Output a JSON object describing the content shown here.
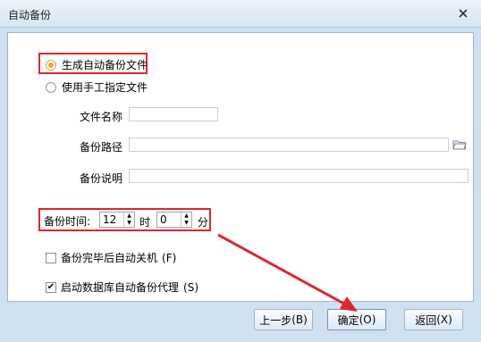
{
  "window": {
    "title": "自动备份"
  },
  "options": {
    "auto_generate": "生成自动备份文件",
    "manual_file": "使用手工指定文件",
    "selected": "auto_generate"
  },
  "fields": {
    "file_name_label": "文件名称",
    "file_name_value": "",
    "backup_path_label": "备份路径",
    "backup_path_value": "",
    "backup_desc_label": "备份说明",
    "backup_desc_value": ""
  },
  "time": {
    "label": "备份时间:",
    "hour": "12",
    "hour_unit": "时",
    "minute": "0",
    "minute_unit": "分"
  },
  "checkboxes": {
    "shutdown_label": "备份完毕后自动关机",
    "shutdown_key": "(F)",
    "shutdown_checked": false,
    "agent_label": "启动数据库自动备份代理",
    "agent_key": "(S)",
    "agent_checked": true
  },
  "buttons": {
    "prev": "上一步",
    "prev_key": "(B)",
    "ok": "确定",
    "ok_key": "(O)",
    "back": "返回",
    "back_key": "(X)"
  },
  "colors": {
    "highlight": "#e0252c",
    "radio_selected": "#f5a623",
    "panel_bg": "#ffffff",
    "window_bg": "#cfe0f0"
  }
}
